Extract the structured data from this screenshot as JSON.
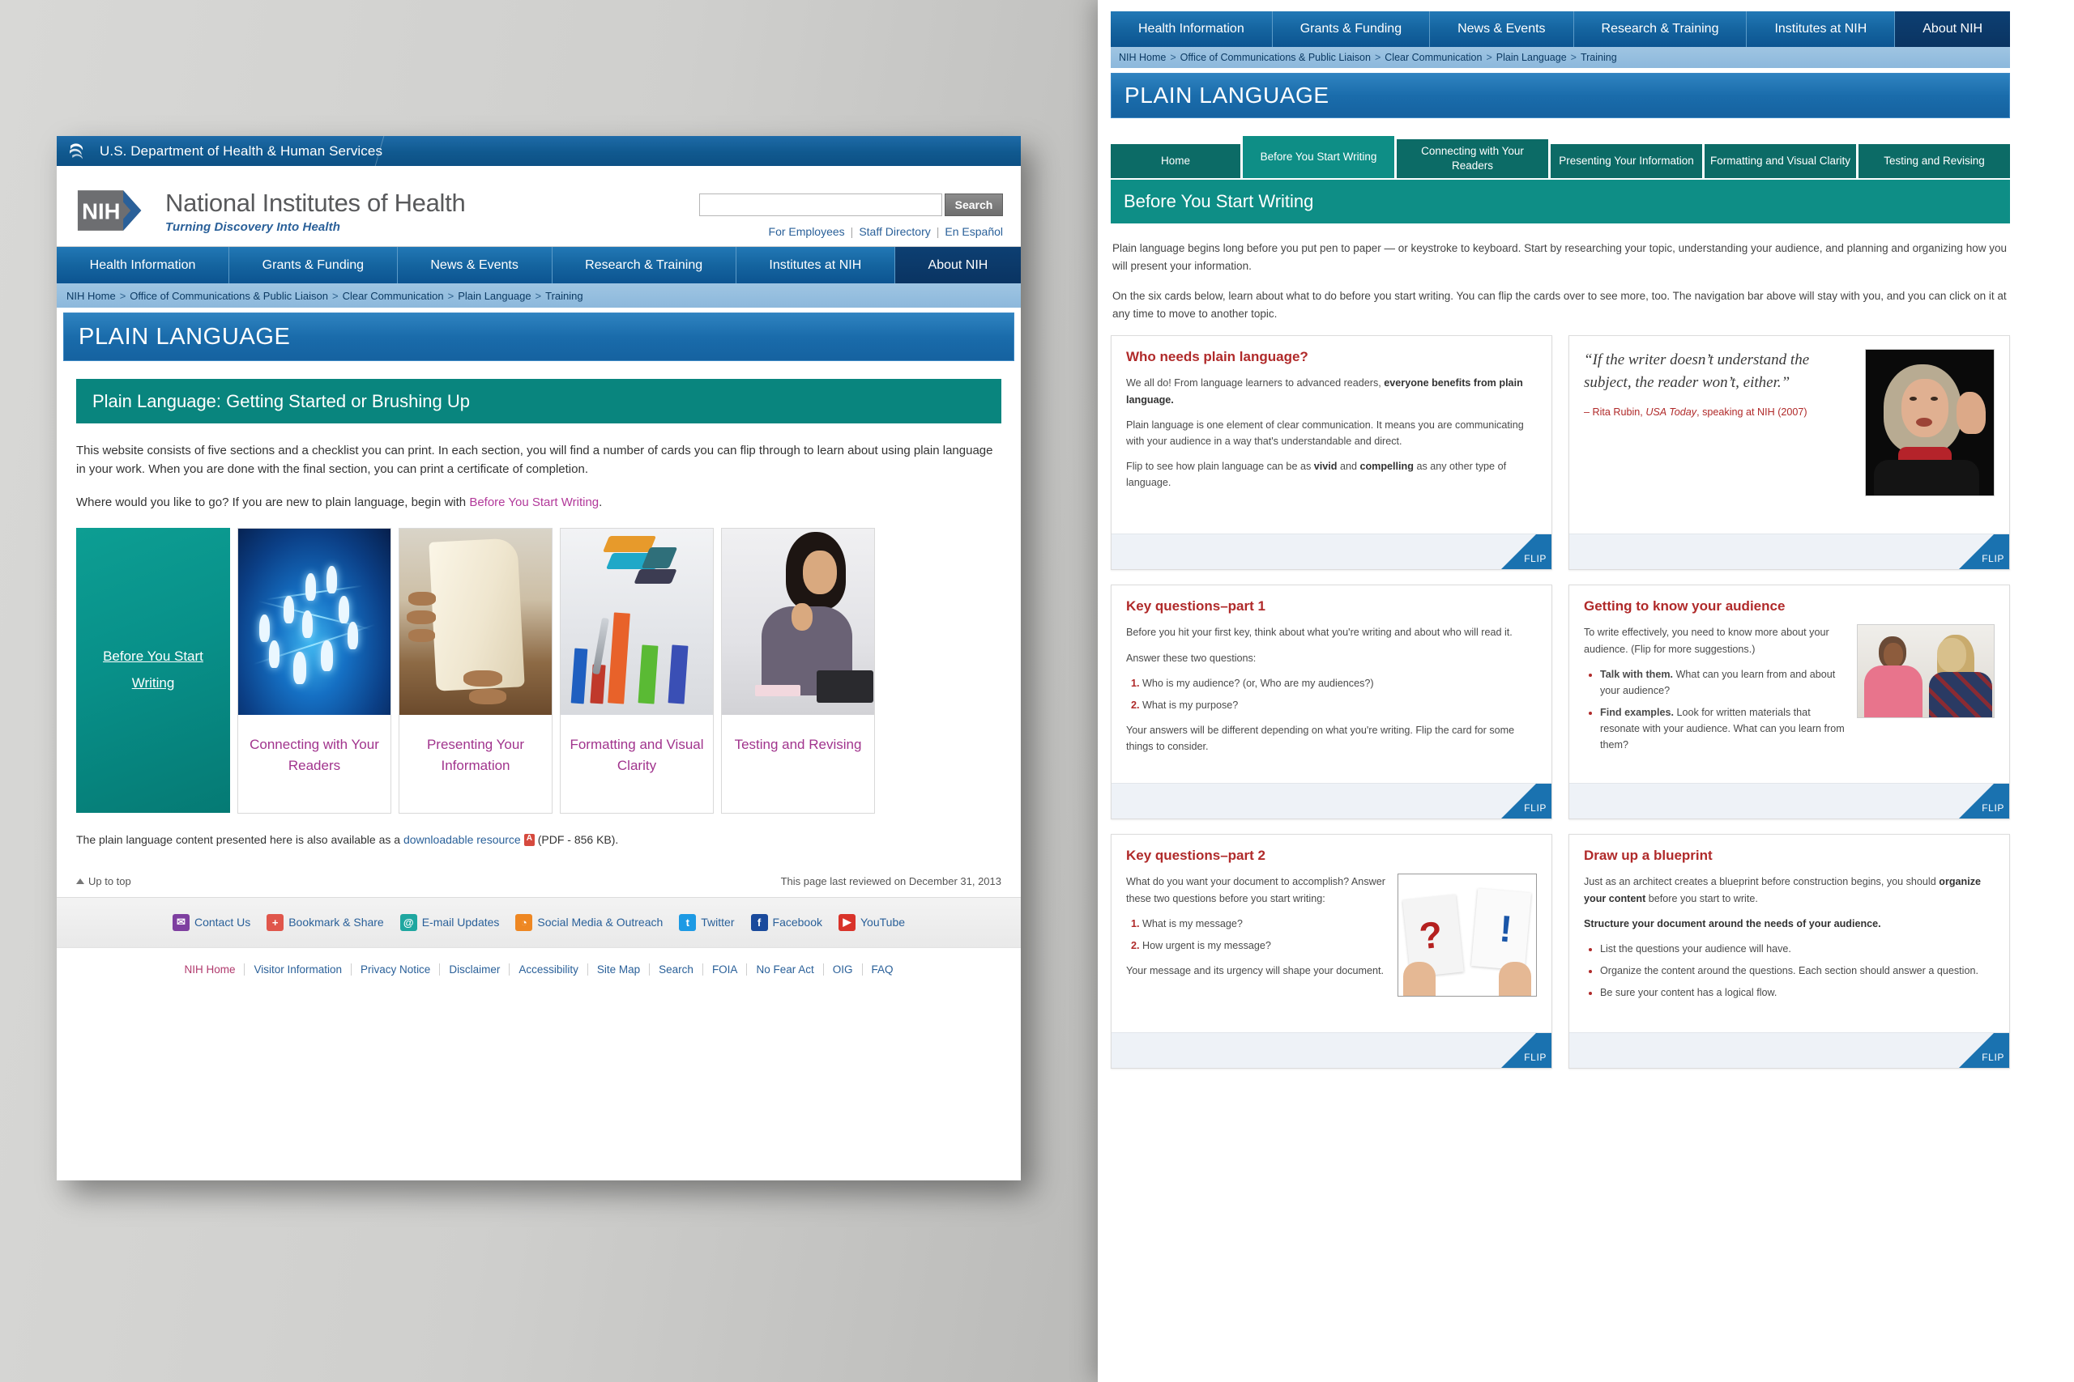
{
  "left": {
    "hhs_banner": "U.S. Department of Health & Human Services",
    "agency_name": "National Institutes of Health",
    "agency_tagline": "Turning Discovery Into Health",
    "logo_text": "NIH",
    "search": {
      "value": "",
      "placeholder": "",
      "button_label": "Search"
    },
    "header_links": [
      "For Employees",
      "Staff Directory",
      "En Español"
    ],
    "mainnav": [
      "Health Information",
      "Grants & Funding",
      "News & Events",
      "Research & Training",
      "Institutes at NIH",
      "About NIH"
    ],
    "mainnav_active": "About NIH",
    "breadcrumb": [
      "NIH Home",
      "Office of Communications & Public Liaison",
      "Clear Communication",
      "Plain Language",
      "Training"
    ],
    "page_title": "PLAIN LANGUAGE",
    "section_title": "Plain Language: Getting Started or Brushing Up",
    "intro_p1": "This website consists of five sections and a checklist you can print. In each section, you will find a number of cards you can flip through to learn about using plain language in your work. When you are done with the final section, you can print a certificate of completion.",
    "intro_p2_pre": "Where would you like to go? If you are new to plain language, begin with ",
    "intro_p2_link": "Before You Start Writing",
    "intro_p2_post": ".",
    "cards": [
      {
        "label": "Before You Start Writing",
        "art": "teal"
      },
      {
        "label": "Connecting with Your Readers",
        "art": "network"
      },
      {
        "label": "Presenting Your Information",
        "art": "hands"
      },
      {
        "label": "Formatting and Visual Clarity",
        "art": "charts"
      },
      {
        "label": "Testing and Revising",
        "art": "woman"
      }
    ],
    "download_pre": "The plain language content presented here is also available as a ",
    "download_link": "downloadable resource",
    "download_post": "(PDF - 856 KB).",
    "up_to_top": "Up to top",
    "last_reviewed": "This page last reviewed on December 31, 2013",
    "social": [
      {
        "label": "Contact Us",
        "icon": "mail-icon",
        "cls": "mail",
        "glyph": "✉"
      },
      {
        "label": "Bookmark & Share",
        "icon": "plus-icon",
        "cls": "plus",
        "glyph": "+"
      },
      {
        "label": "E-mail Updates",
        "icon": "at-icon",
        "cls": "at",
        "glyph": "@"
      },
      {
        "label": "Social Media & Outreach",
        "icon": "rss-icon",
        "cls": "rss",
        "glyph": "◠"
      },
      {
        "label": "Twitter",
        "icon": "twitter-icon",
        "cls": "tw",
        "glyph": "t"
      },
      {
        "label": "Facebook",
        "icon": "facebook-icon",
        "cls": "fb",
        "glyph": "f"
      },
      {
        "label": "YouTube",
        "icon": "youtube-icon",
        "cls": "yt",
        "glyph": "▶"
      }
    ],
    "footer_links": [
      "NIH Home",
      "Visitor Information",
      "Privacy Notice",
      "Disclaimer",
      "Accessibility",
      "Site Map",
      "Search",
      "FOIA",
      "No Fear Act",
      "OIG",
      "FAQ"
    ]
  },
  "right": {
    "mainnav": [
      "Health Information",
      "Grants & Funding",
      "News & Events",
      "Research & Training",
      "Institutes at NIH",
      "About NIH"
    ],
    "mainnav_active": "About NIH",
    "breadcrumb": [
      "NIH Home",
      "Office of Communications & Public Liaison",
      "Clear Communication",
      "Plain Language",
      "Training"
    ],
    "page_title": "PLAIN LANGUAGE",
    "tabs": [
      {
        "label": "Home",
        "active": false
      },
      {
        "label": "Before You Start Writing",
        "active": true
      },
      {
        "label": "Connecting with Your Readers",
        "active": false
      },
      {
        "label": "Presenting Your Information",
        "active": false
      },
      {
        "label": "Formatting and Visual Clarity",
        "active": false
      },
      {
        "label": "Testing and Revising",
        "active": false
      }
    ],
    "section_title": "Before You Start Writing",
    "intro_p1": "Plain language begins long before you put pen to paper — or keystroke to keyboard. Start by researching your topic, understanding your audience, and planning and organizing how you will present your information.",
    "intro_p2": "On the six cards below, learn about what to do before you start writing. You can flip the cards over to see more, too. The navigation bar above will stay with you, and you can click on it at any time to move to another topic.",
    "flip_label": "FLIP",
    "cards": [
      {
        "id": "who-needs-plain-language",
        "title": "Who needs plain language?",
        "paras": [
          {
            "pre": "We all do! From language learners to advanced readers, ",
            "bold": "everyone benefits from plain language.",
            "post": ""
          },
          {
            "pre": "Plain language is one element of clear communication.  It means you are communicating with your audience in a way that's understandable and direct.",
            "bold": "",
            "post": ""
          },
          {
            "pre": "Flip to see how plain language can be as ",
            "bold": "vivid",
            "mid": " and ",
            "bold2": "compelling",
            "post": " as any other type of language."
          }
        ]
      },
      {
        "id": "quote-rita-rubin",
        "quote": "“If the writer doesn’t understand the subject, the reader won’t, either.”",
        "attr_pre": "– Rita Rubin, ",
        "attr_italic": "USA Today",
        "attr_post": ", speaking at NIH (2007)",
        "photo": "rita-rubin-photo"
      },
      {
        "id": "key-questions-part-1",
        "title": "Key questions–part 1",
        "p1": "Before you hit your first key, think about what you're writing and about who will read it.",
        "p2": "Answer these two questions:",
        "list": [
          "Who is my audience? (or, Who are my audiences?)",
          "What is my purpose?"
        ],
        "p3": "Your answers will be different depending on what you're writing. Flip the card for some things to consider."
      },
      {
        "id": "getting-to-know-your-audience",
        "title": "Getting to know your audience",
        "p1": "To write effectively, you need to know more about your audience. (Flip for more suggestions.)",
        "bullets": [
          {
            "bold": "Talk with them.",
            "text": " What can you learn from and about your audience?"
          },
          {
            "bold": "Find examples.",
            "text": " Look for written materials that resonate with your audience. What can you learn from them?"
          }
        ],
        "photo": "audience-conversation-photo"
      },
      {
        "id": "key-questions-part-2",
        "title": "Key questions–part 2",
        "p1": "What do you want your document to accomplish? Answer these two questions before you start writing:",
        "list": [
          "What is my message?",
          "How urgent is my message?"
        ],
        "p3": "Your message and its urgency will shape your document.",
        "photo": "question-exclamation-photo"
      },
      {
        "id": "draw-up-a-blueprint",
        "title": "Draw up a blueprint",
        "p1_pre": "Just as an architect creates a blueprint before construction begins, you should ",
        "p1_bold": "organize your content",
        "p1_post": " before you start to write.",
        "p2_bold": "Structure your document around the needs of your audience.",
        "bullets": [
          "List the questions your audience will have.",
          "Organize the content around the questions. Each section should answer a question.",
          "Be sure your content has a logical flow."
        ]
      }
    ]
  },
  "colors": {
    "nih_blue": "#1565a0",
    "nih_dark_blue": "#0d3f72",
    "teal": "#0e8e86",
    "teal_dark": "#0c6b66",
    "card_heading_red": "#b02a2a",
    "link_magenta": "#a1348d",
    "flip_blue": "#1a72b0"
  }
}
